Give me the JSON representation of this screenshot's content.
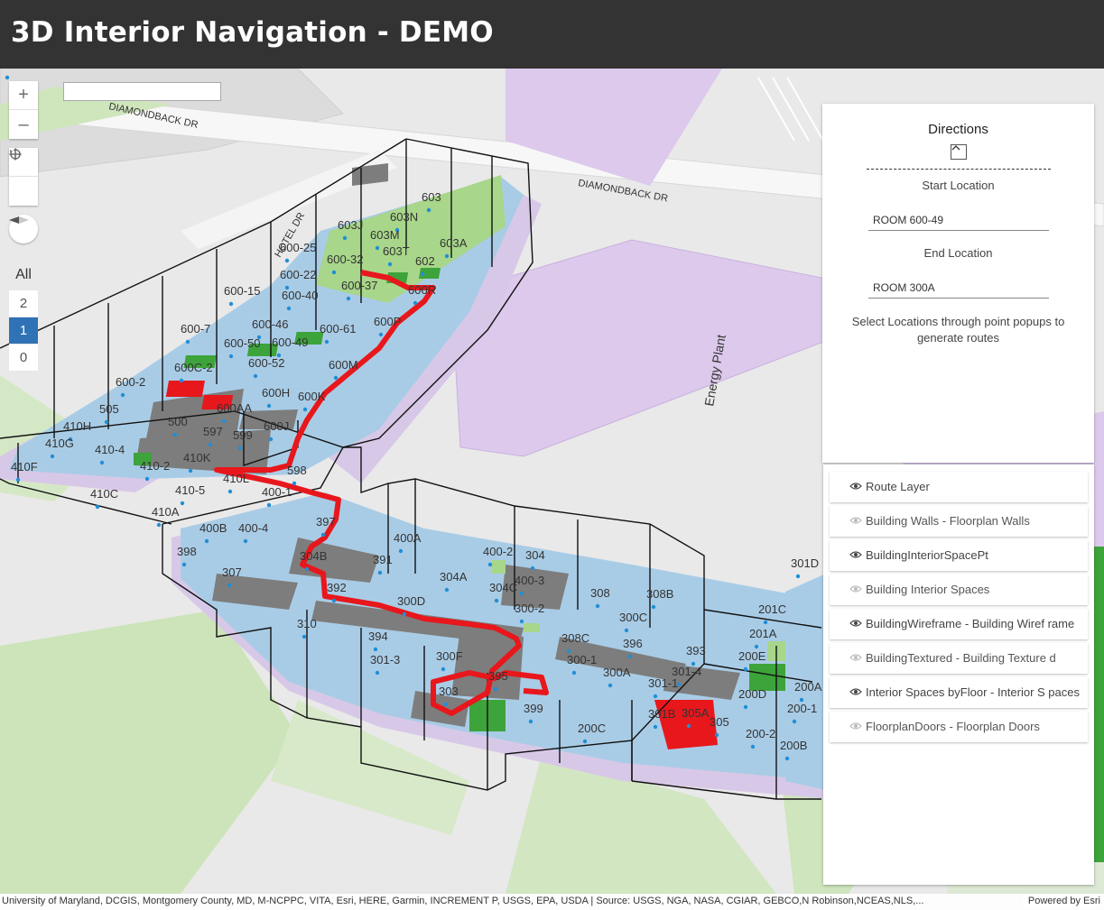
{
  "app": {
    "title": "3D Interior Navigation - DEMO"
  },
  "search": {
    "value": ""
  },
  "map_controls": {
    "zoom_in": "+",
    "zoom_out": "–"
  },
  "floor_picker": {
    "all_label": "All",
    "floors": [
      "2",
      "1",
      "0"
    ],
    "active_floor": "1"
  },
  "directions": {
    "title": "Directions",
    "start_label": "Start Location",
    "start_value": "ROOM 600-49",
    "end_label": "End Location",
    "end_value": "ROOM 300A",
    "help_text": "Select Locations through point popups to generate routes"
  },
  "layers": [
    {
      "label": "Route Layer",
      "visible": true
    },
    {
      "label": "Building Walls - Floorplan Walls",
      "visible": false
    },
    {
      "label": "BuildingInteriorSpacePt",
      "visible": true
    },
    {
      "label": "Building Interior Spaces",
      "visible": false
    },
    {
      "label": "BuildingWireframe - Building Wiref rame",
      "visible": true
    },
    {
      "label": "BuildingTextured - Building Texture d",
      "visible": false
    },
    {
      "label": "Interior Spaces byFloor - Interior S paces",
      "visible": true
    },
    {
      "label": "FloorplanDoors - Floorplan Doors",
      "visible": false
    }
  ],
  "map_labels": {
    "streets": [
      "DIAMONDBACK DR",
      "DIAMONDBACK DR",
      "HOTEL DR"
    ],
    "building": "Energy Plant",
    "rooms": [
      "603",
      "603N",
      "603J",
      "603M",
      "603A",
      "603T",
      "602",
      "600-25",
      "600-32",
      "600-22",
      "600-37",
      "600R",
      "600-15",
      "600-40",
      "600-7",
      "600-46",
      "600-61",
      "600P",
      "600-50",
      "600-49",
      "600C-2",
      "600-52",
      "600M",
      "600-2",
      "600H",
      "600K",
      "505",
      "600AA",
      "500",
      "600J",
      "410H",
      "597",
      "599",
      "410G",
      "410-4",
      "410K",
      "598",
      "410F",
      "410-2",
      "410L",
      "400-1",
      "410-5",
      "410C",
      "410A",
      "397",
      "400B",
      "400-4",
      "400A",
      "400-2",
      "304",
      "304B",
      "391",
      "398",
      "304A",
      "400-3",
      "307",
      "304C",
      "392",
      "300D",
      "300-2",
      "308",
      "308B",
      "310",
      "300C",
      "308C",
      "396",
      "393",
      "394",
      "300-1",
      "301-3",
      "300F",
      "300A",
      "301-4",
      "395",
      "301-1",
      "303",
      "399",
      "301B",
      "305A",
      "305",
      "200C",
      "301D",
      "201C",
      "201A",
      "200E",
      "200D",
      "200-1",
      "200-2",
      "200B",
      "200A",
      "200-"
    ]
  },
  "attribution": "University of Maryland, DCGIS, Montgomery County, MD, M-NCPPC, VITA, Esri, HERE, Garmin, INCREMENT P, USGS, EPA, USDA | Source: USGS, NGA, NASA, CGIAR, GEBCO,N Robinson,NCEAS,NLS,...",
  "powered_by": "Powered by Esri",
  "colors": {
    "header": "#333333",
    "room_fill": "#a9cce6",
    "corridor": "#7a7a7a",
    "route": "#e8171c",
    "green_room": "#a8d68a",
    "dark_green_room": "#3da33b",
    "energy_plant": "#dcc9ec",
    "active_floor": "#2f72b5"
  }
}
